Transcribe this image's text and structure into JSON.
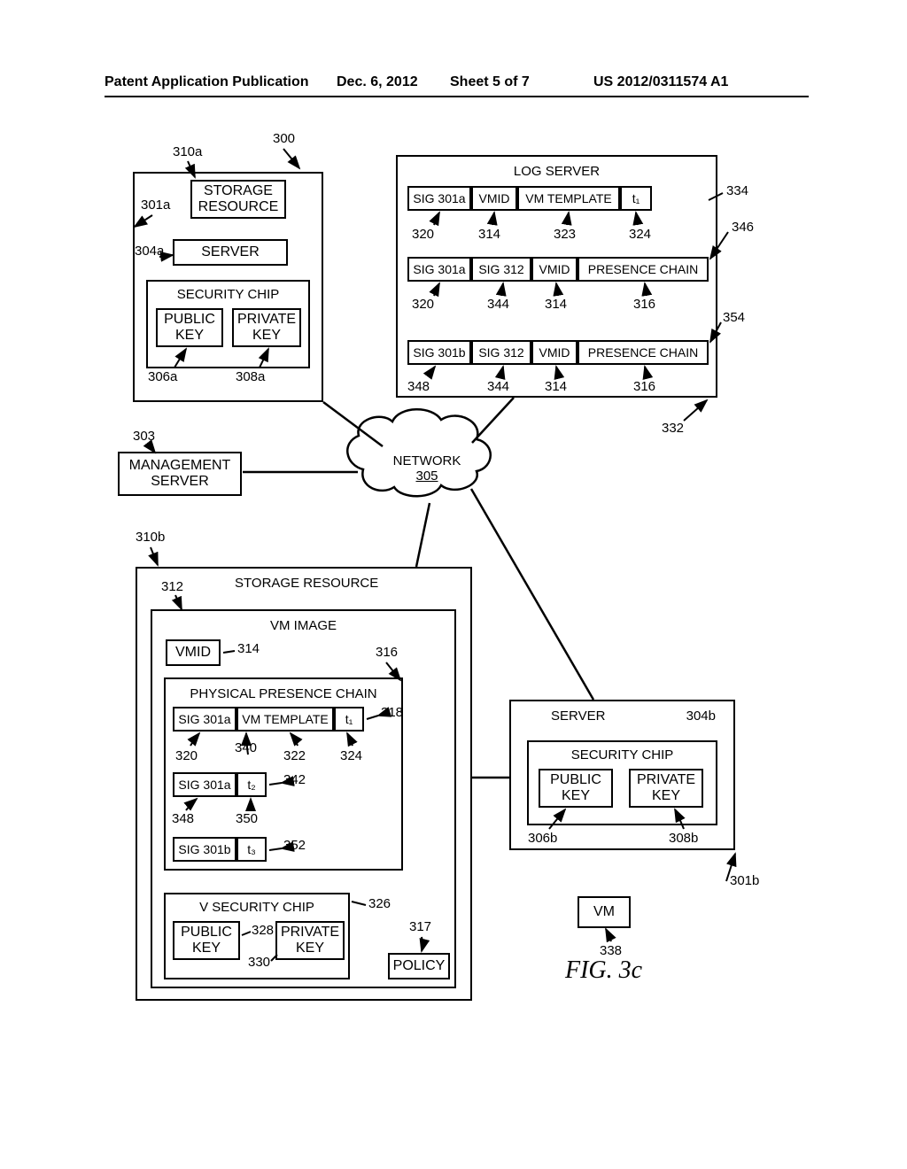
{
  "header": {
    "left": "Patent Application Publication",
    "date": "Dec. 6, 2012",
    "sheet": "Sheet 5 of 7",
    "pubno": "US 2012/0311574 A1"
  },
  "refs": {
    "n300": "300",
    "n310a": "310a",
    "n301a": "301a",
    "n304a": "304a",
    "n306a": "306a",
    "n308a": "308a",
    "n303": "303",
    "n305": "305",
    "n310b": "310b",
    "n312": "312",
    "n314": "314",
    "n314_2": "314",
    "n314_3": "314",
    "n316": "316",
    "n316_2": "316",
    "n316_3": "316",
    "n317": "317",
    "n318": "318",
    "n320": "320",
    "n320_2": "320",
    "n322": "322",
    "n323": "323",
    "n324": "324",
    "n324_2": "324",
    "n326": "326",
    "n328": "328",
    "n330": "330",
    "n332": "332",
    "n334": "334",
    "n338": "338",
    "n340": "340",
    "n342": "342",
    "n344": "344",
    "n344_2": "344",
    "n346": "346",
    "n348": "348",
    "n348_2": "348",
    "n350": "350",
    "n352": "352",
    "n354": "354",
    "n301b": "301b",
    "n304b": "304b",
    "n306b": "306b",
    "n308b": "308b"
  },
  "text": {
    "storage_resource": "STORAGE RESOURCE",
    "storage": "STORAGE",
    "resource": "RESOURCE",
    "server": "SERVER",
    "security_chip": "SECURITY CHIP",
    "public": "PUBLIC",
    "private": "PRIVATE",
    "key": "KEY",
    "management": "MANAGEMENT",
    "network": "NETWORK",
    "log_server": "LOG SERVER",
    "sig301a": "SIG 301a",
    "sig301b": "SIG 301b",
    "sig312": "SIG 312",
    "vmid": "VMID",
    "vm_template": "VM TEMPLATE",
    "presence_chain": "PRESENCE CHAIN",
    "t1": "t₁",
    "t2": "t₂",
    "t3": "t₃",
    "vm_image": "VM IMAGE",
    "physical_presence_chain": "PHYSICAL PRESENCE CHAIN",
    "v_security_chip": "V SECURITY CHIP",
    "policy": "POLICY",
    "vm": "VM",
    "fig": "FIG. 3c"
  }
}
